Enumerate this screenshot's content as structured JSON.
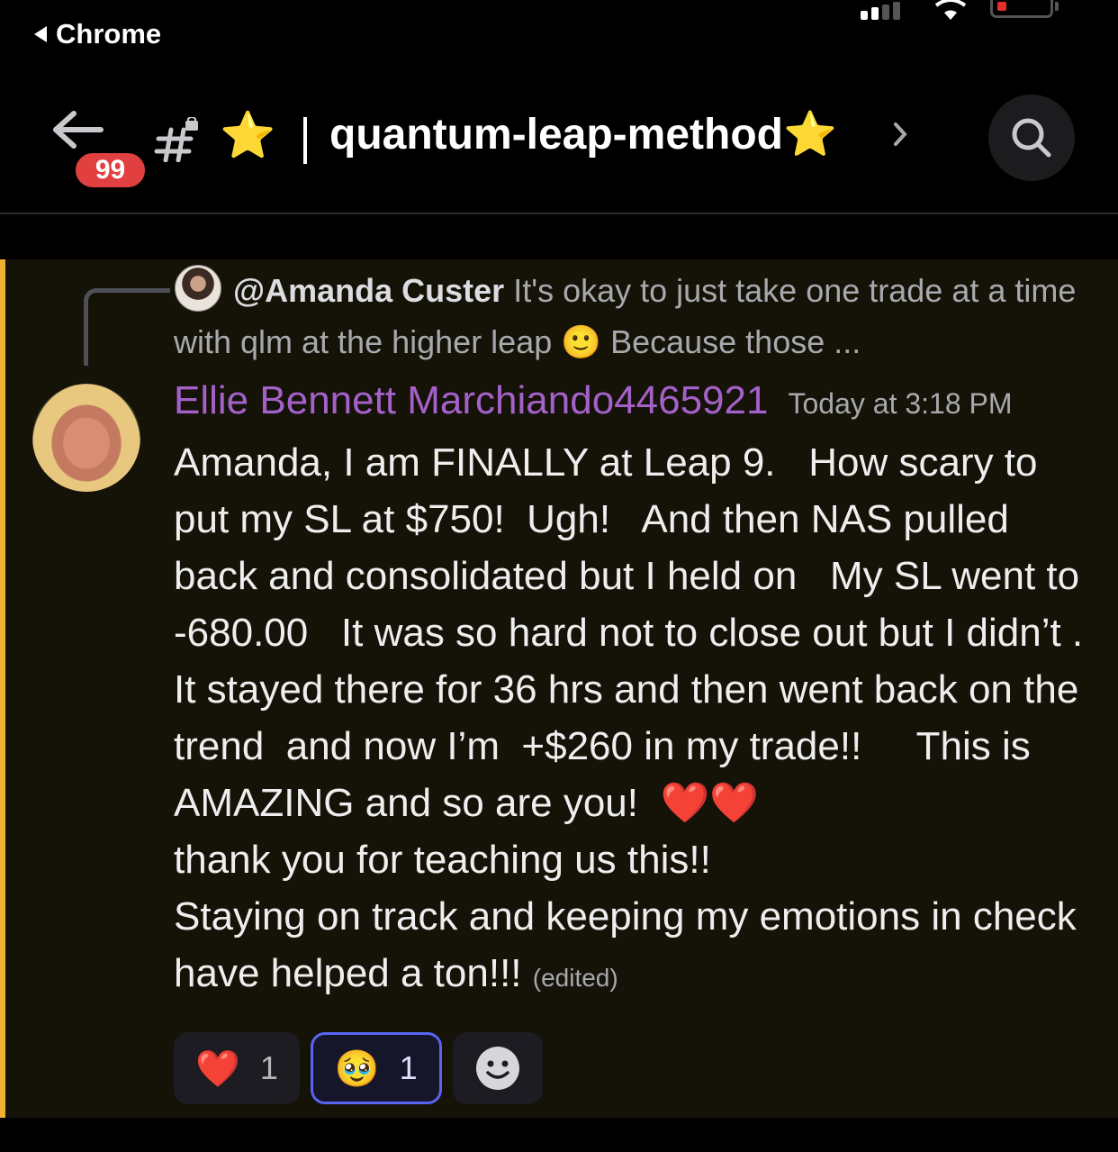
{
  "status_bar": {
    "back_app": "Chrome"
  },
  "header": {
    "unread_count": "99",
    "channel_emoji": "⭐",
    "channel_name": "quantum-leap-method⭐",
    "icons": [
      "back-arrow-icon",
      "locked-hash-icon",
      "chevron-right-icon",
      "search-icon"
    ]
  },
  "reply": {
    "author": "@Amanda Custer",
    "text": "It's okay to just take one trade at a time with qlm at the higher leap 🙂 Because those ..."
  },
  "message": {
    "author": "Ellie Bennett Marchiando4465921",
    "timestamp": "Today at 3:18 PM",
    "body_main": "Amanda, I am FINALLY at Leap 9.   How scary to put my SL at $750!  Ugh!   And then NAS pulled back and consolidated but I held on   My SL went to -680.00   It was so hard not to close out but I didn’t .  It stayed there for 36 hrs and then went back on the trend  and now I’m  +$260 in my trade!!     This is AMAZING and so are you!  ",
    "hearts": "❤️❤️",
    "body_end": "\nthank you for teaching us this!!\nStaying on track and keeping my emotions in check have helped a ton!!!",
    "edited": "(edited)"
  },
  "reactions": [
    {
      "emoji": "❤️",
      "count": "1"
    },
    {
      "emoji": "🥹",
      "count": "1"
    }
  ],
  "colors": {
    "accent_bar": "#f0b232",
    "author": "#a461c9",
    "badge": "#e24040",
    "active_reaction_border": "#5865f2"
  }
}
